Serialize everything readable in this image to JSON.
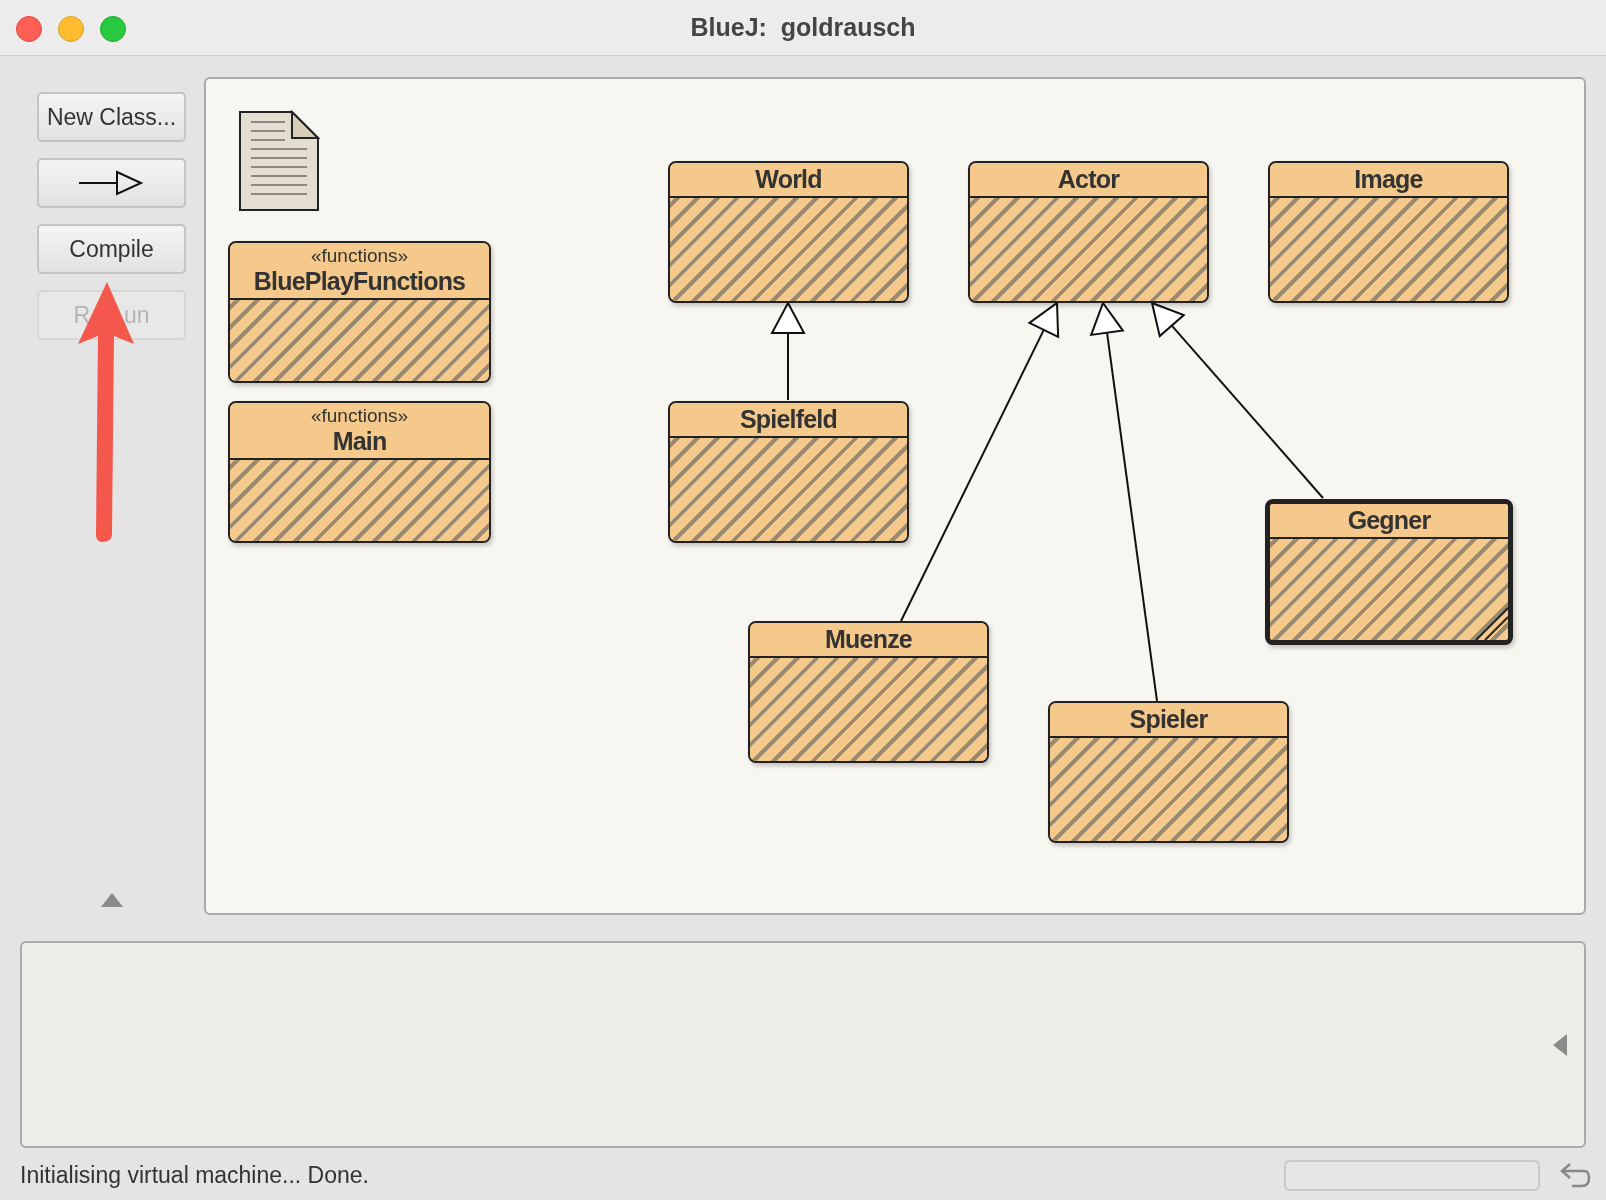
{
  "window": {
    "title": "BlueJ:  goldrausch"
  },
  "toolbar": {
    "buttons": [
      {
        "kind": "text",
        "label": "New Class...",
        "disabled": false
      },
      {
        "kind": "arrow",
        "disabled": false
      },
      {
        "kind": "text",
        "label": "Compile",
        "disabled": false
      },
      {
        "kind": "partial",
        "label_parts": [
          "R",
          "un"
        ],
        "disabled": true
      }
    ]
  },
  "diagram": {
    "classes": [
      {
        "name": "BluePlayFunctions",
        "stereotype": "«functions»",
        "selected": false
      },
      {
        "name": "Main",
        "stereotype": "«functions»",
        "selected": false
      },
      {
        "name": "World",
        "selected": false
      },
      {
        "name": "Actor",
        "selected": false
      },
      {
        "name": "Image",
        "selected": false
      },
      {
        "name": "Spielfeld",
        "selected": false
      },
      {
        "name": "Gegner",
        "selected": true
      },
      {
        "name": "Muenze",
        "selected": false
      },
      {
        "name": "Spieler",
        "selected": false
      }
    ]
  },
  "status_bar": {
    "message": "Initialising virtual machine... Done."
  }
}
